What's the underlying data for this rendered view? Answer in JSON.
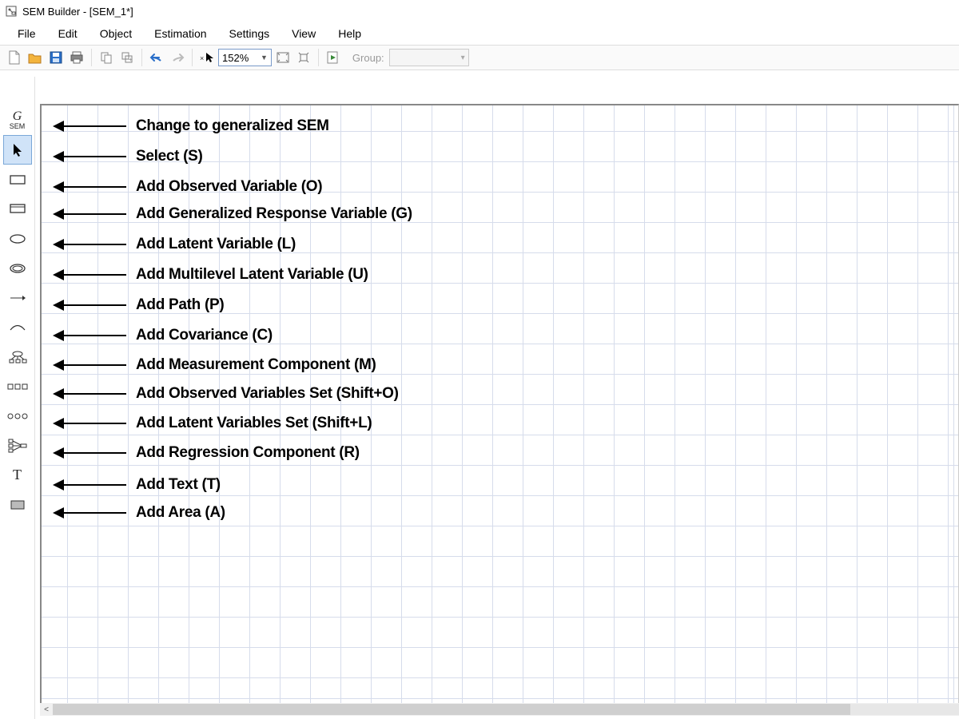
{
  "title": "SEM Builder - [SEM_1*]",
  "menu": [
    "File",
    "Edit",
    "Object",
    "Estimation",
    "Settings",
    "View",
    "Help"
  ],
  "zoom_value": "152%",
  "group_label": "Group:",
  "tool_panel": [
    {
      "name": "gsem",
      "label": "Change to generalized SEM"
    },
    {
      "name": "select",
      "label": "Select (S)"
    },
    {
      "name": "observed-var",
      "label": "Add Observed Variable (O)"
    },
    {
      "name": "gen-response",
      "label": "Add Generalized Response Variable (G)"
    },
    {
      "name": "latent-var",
      "label": "Add Latent Variable (L)"
    },
    {
      "name": "multilevel-latent",
      "label": "Add Multilevel Latent Variable (U)"
    },
    {
      "name": "path",
      "label": "Add Path (P)"
    },
    {
      "name": "covariance",
      "label": "Add Covariance (C)"
    },
    {
      "name": "measurement",
      "label": "Add Measurement Component (M)"
    },
    {
      "name": "observed-set",
      "label": "Add Observed Variables Set (Shift+O)"
    },
    {
      "name": "latent-set",
      "label": "Add Latent Variables Set (Shift+L)"
    },
    {
      "name": "regression",
      "label": "Add Regression Component (R)"
    },
    {
      "name": "text",
      "label": "Add Text (T)"
    },
    {
      "name": "area",
      "label": "Add Area (A)"
    }
  ]
}
